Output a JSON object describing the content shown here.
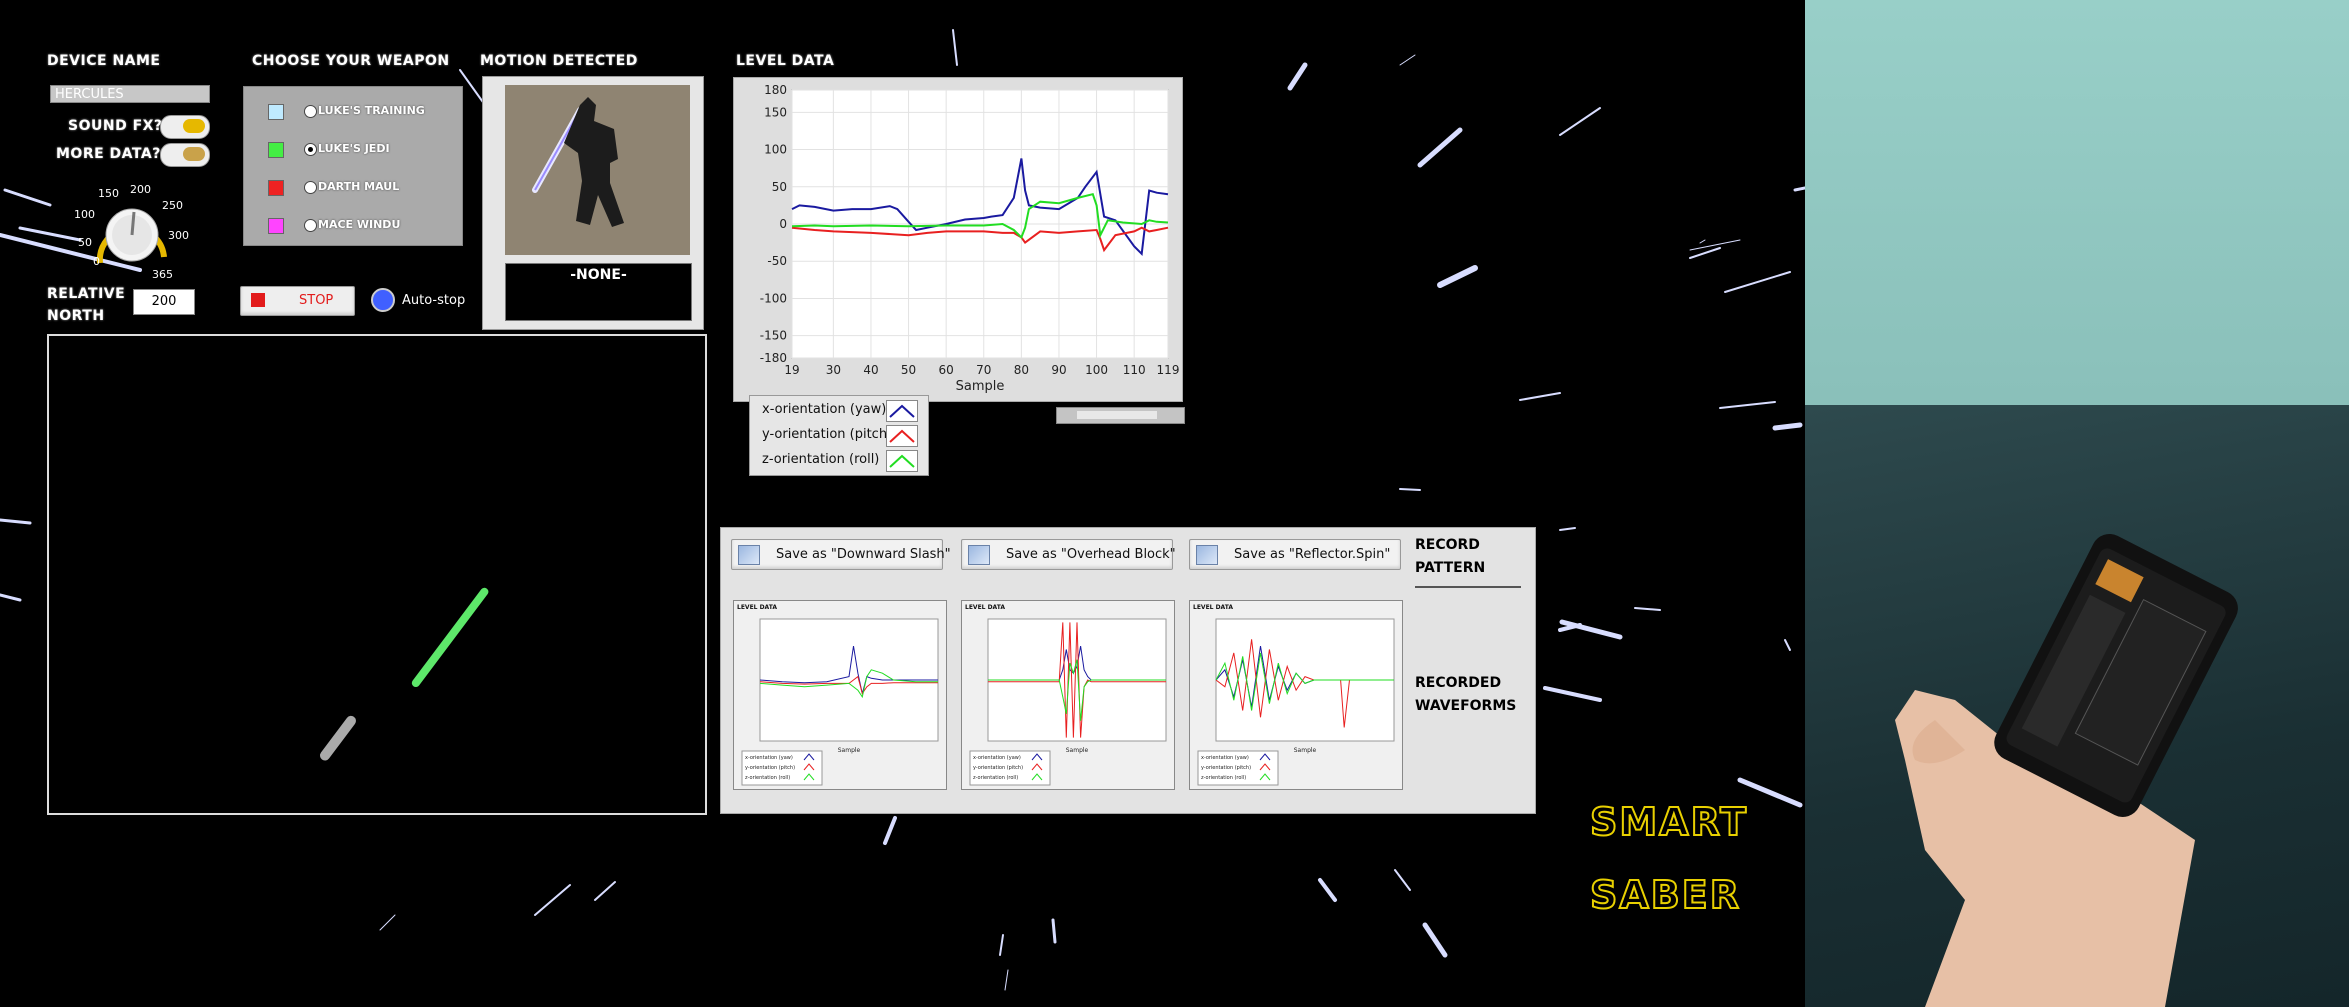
{
  "labels": {
    "device_name": "DEVICE NAME",
    "sound_fx": "SOUND FX?",
    "more_data": "MORE DATA?",
    "relative_north": "RELATIVE\nNORTH",
    "choose_weapon": "CHOOSE YOUR WEAPON",
    "motion_detected": "MOTION DETECTED",
    "level_data": "LEVEL DATA",
    "record_pattern": "RECORD\nPATTERN",
    "recorded_waveforms": "RECORDED\nWAVEFORMS",
    "smart": "SMART",
    "saber": "SABER"
  },
  "device_name_value": "HERCULES",
  "knob": {
    "ticks": [
      "0",
      "50",
      "100",
      "150",
      "200",
      "250",
      "300",
      "365"
    ],
    "value": 200
  },
  "relative_north_value": "200",
  "weapons": [
    {
      "label": "LUKE'S TRAINING",
      "color": "#bfeaff",
      "selected": false
    },
    {
      "label": "LUKE'S JEDI",
      "color": "#44ee44",
      "selected": true
    },
    {
      "label": "DARTH MAUL",
      "color": "#ee2222",
      "selected": false
    },
    {
      "label": "MACE WINDU",
      "color": "#ff44ff",
      "selected": false
    }
  ],
  "stop_button": "STOP",
  "auto_stop": "Auto-stop",
  "motion_value": "-NONE-",
  "chart_data": [
    {
      "type": "line",
      "title": "LEVEL DATA",
      "xlabel": "Sample",
      "ylabel": "",
      "xlim": [
        19,
        119
      ],
      "ylim": [
        -180,
        180
      ],
      "x_ticks": [
        19,
        30,
        40,
        50,
        60,
        70,
        80,
        90,
        100,
        110,
        119
      ],
      "y_ticks": [
        180,
        150,
        100,
        50,
        0,
        -50,
        -100,
        -150,
        -180
      ],
      "grid": true,
      "legend_position": "below-left",
      "series": [
        {
          "name": "x-orientation (yaw)",
          "color": "#1a1aa0",
          "x": [
            19,
            21,
            25,
            30,
            35,
            40,
            45,
            47,
            50,
            52,
            55,
            60,
            65,
            70,
            72,
            75,
            78,
            80,
            81,
            82,
            85,
            90,
            95,
            97,
            100,
            102,
            105,
            110,
            112,
            114,
            116,
            119
          ],
          "y": [
            20,
            25,
            23,
            18,
            20,
            20,
            24,
            20,
            3,
            -8,
            -5,
            0,
            6,
            8,
            10,
            12,
            35,
            88,
            45,
            25,
            22,
            20,
            35,
            50,
            70,
            10,
            5,
            -30,
            -40,
            45,
            42,
            40
          ]
        },
        {
          "name": "y-orientation (pitch)",
          "color": "#e82020",
          "x": [
            19,
            25,
            30,
            40,
            50,
            55,
            60,
            70,
            75,
            78,
            80,
            81,
            85,
            90,
            95,
            100,
            101,
            102,
            105,
            110,
            112,
            114,
            116,
            119
          ],
          "y": [
            -5,
            -8,
            -10,
            -12,
            -15,
            -12,
            -10,
            -10,
            -12,
            -12,
            -18,
            -25,
            -10,
            -12,
            -10,
            -8,
            -20,
            -35,
            -15,
            -10,
            -5,
            -10,
            -8,
            -5
          ]
        },
        {
          "name": "z-orientation (roll)",
          "color": "#22dd22",
          "x": [
            19,
            25,
            30,
            40,
            50,
            60,
            70,
            75,
            78,
            80,
            81,
            82,
            85,
            90,
            95,
            99,
            100,
            101,
            103,
            107,
            112,
            114,
            116,
            119
          ],
          "y": [
            -3,
            -2,
            -3,
            -2,
            -3,
            -2,
            -2,
            0,
            -8,
            -18,
            -5,
            20,
            30,
            28,
            35,
            40,
            25,
            -15,
            5,
            2,
            0,
            5,
            3,
            2
          ]
        }
      ]
    },
    {
      "type": "line",
      "title": "LEVEL DATA",
      "xlabel": "Sample",
      "ylim": [
        -180,
        180
      ],
      "series": [
        {
          "name": "x-orientation (yaw)",
          "color": "#1a1aa0",
          "x": [
            0,
            10,
            20,
            30,
            40,
            42,
            44,
            46,
            48,
            50,
            55,
            60,
            70,
            80
          ],
          "y": [
            0,
            -5,
            -8,
            -5,
            10,
            100,
            20,
            -40,
            10,
            5,
            0,
            0,
            0,
            0
          ]
        },
        {
          "name": "y-orientation (pitch)",
          "color": "#e82020",
          "x": [
            0,
            10,
            20,
            30,
            40,
            44,
            46,
            48,
            50,
            55,
            60,
            70,
            80
          ],
          "y": [
            -5,
            -10,
            -12,
            -10,
            -10,
            10,
            -40,
            -20,
            -10,
            -10,
            -8,
            -8,
            -8
          ]
        },
        {
          "name": "z-orientation (roll)",
          "color": "#22dd22",
          "x": [
            0,
            10,
            20,
            30,
            40,
            44,
            46,
            48,
            50,
            55,
            60,
            70,
            80
          ],
          "y": [
            -10,
            -15,
            -20,
            -15,
            -10,
            -30,
            -50,
            10,
            30,
            20,
            0,
            -5,
            -5
          ]
        }
      ]
    },
    {
      "type": "line",
      "title": "LEVEL DATA",
      "xlabel": "Sample",
      "ylim": [
        -180,
        180
      ],
      "series": [
        {
          "name": "x-orientation (yaw)",
          "color": "#1a1aa0",
          "x": [
            0,
            10,
            20,
            40,
            42,
            44,
            46,
            48,
            50,
            52,
            54,
            56,
            58,
            60,
            80,
            100
          ],
          "y": [
            0,
            0,
            0,
            0,
            30,
            90,
            30,
            20,
            40,
            100,
            30,
            10,
            0,
            0,
            0,
            0
          ]
        },
        {
          "name": "y-orientation (pitch)",
          "color": "#e82020",
          "x": [
            0,
            10,
            20,
            40,
            42,
            44,
            46,
            48,
            50,
            52,
            54,
            56,
            58,
            60,
            80,
            100
          ],
          "y": [
            -5,
            -5,
            -5,
            -5,
            170,
            -170,
            170,
            -170,
            170,
            -170,
            -20,
            0,
            -5,
            -5,
            -5,
            -5
          ]
        },
        {
          "name": "z-orientation (roll)",
          "color": "#22dd22",
          "x": [
            0,
            10,
            20,
            40,
            42,
            44,
            46,
            48,
            50,
            52,
            54,
            56,
            58,
            60,
            80,
            100
          ],
          "y": [
            0,
            0,
            0,
            0,
            -50,
            -100,
            50,
            20,
            60,
            -120,
            -20,
            -5,
            0,
            0,
            0,
            0
          ]
        }
      ]
    },
    {
      "type": "line",
      "title": "LEVEL DATA",
      "xlabel": "Sample",
      "ylim": [
        -180,
        180
      ],
      "series": [
        {
          "name": "x-orientation (yaw)",
          "color": "#1a1aa0",
          "x": [
            0,
            5,
            10,
            15,
            20,
            25,
            30,
            35,
            40,
            45,
            50,
            55,
            60,
            65,
            70,
            75,
            80,
            90,
            100
          ],
          "y": [
            0,
            30,
            -50,
            60,
            -80,
            100,
            -60,
            40,
            -30,
            20,
            -10,
            0,
            0,
            0,
            0,
            0,
            0,
            0,
            0
          ]
        },
        {
          "name": "y-orientation (pitch)",
          "color": "#e82020",
          "x": [
            0,
            5,
            10,
            15,
            20,
            25,
            30,
            35,
            40,
            45,
            50,
            55,
            60,
            65,
            70,
            72,
            75,
            80,
            90,
            100
          ],
          "y": [
            0,
            -20,
            80,
            -90,
            120,
            -110,
            90,
            -60,
            40,
            -30,
            10,
            0,
            0,
            0,
            0,
            -140,
            0,
            0,
            0,
            0
          ]
        },
        {
          "name": "z-orientation (roll)",
          "color": "#22dd22",
          "x": [
            0,
            5,
            10,
            15,
            20,
            25,
            30,
            35,
            40,
            45,
            50,
            55,
            60,
            70,
            80,
            90,
            100
          ],
          "y": [
            0,
            50,
            -60,
            70,
            -90,
            80,
            -70,
            50,
            -40,
            20,
            -10,
            0,
            0,
            0,
            0,
            0,
            0
          ]
        }
      ]
    }
  ],
  "save_buttons": [
    "Save as  \"Downward Slash\"",
    "Save as \"Overhead Block\"",
    "Save as \"Reflector.Spin\""
  ]
}
